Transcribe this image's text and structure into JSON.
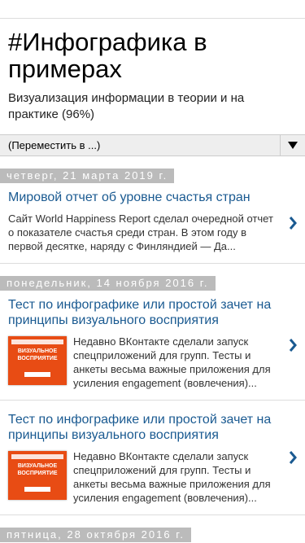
{
  "header": {
    "title": "#Инфографика в примерах",
    "description": "Визуализация информации в теории и на практике (96%)"
  },
  "nav": {
    "dropdown_label": "(Переместить в ...)"
  },
  "dates": [
    "четверг, 21 марта 2019 г.",
    "понедельник, 14 ноября 2016 г.",
    "пятница, 28 октября 2016 г."
  ],
  "posts": [
    {
      "title": "Мировой отчет об уровне счастья стран",
      "snippet": "Сайт World Happiness Report сделал очередной отчет о показателе счастья среди стран. В этом году в первой десятке, наряду с Финляндией — Да..."
    },
    {
      "title": "Тест по инфографике или простой зачет на принципы визуального восприятия",
      "snippet": "Недавно ВКонтакте сделали запуск спецприложений для групп. Тесты и анкеты весьма важные приложения для усиления engagement (вовлечения)...",
      "thumb_text": "ВИЗУАЛЬНОЕ ВОСПРИЯТИЕ"
    },
    {
      "title": "Тест по инфографике или простой зачет на принципы визуального восприятия",
      "snippet": "Недавно ВКонтакте сделали запуск спецприложений для групп. Тесты и анкеты весьма важные приложения для усиления engagement (вовлечения)...",
      "thumb_text": "ВИЗУАЛЬНОЕ ВОСПРИЯТИЕ"
    }
  ],
  "colors": {
    "link": "#1a5a91",
    "date_bg": "#bbbbbb",
    "thumb": "#e84c14"
  }
}
